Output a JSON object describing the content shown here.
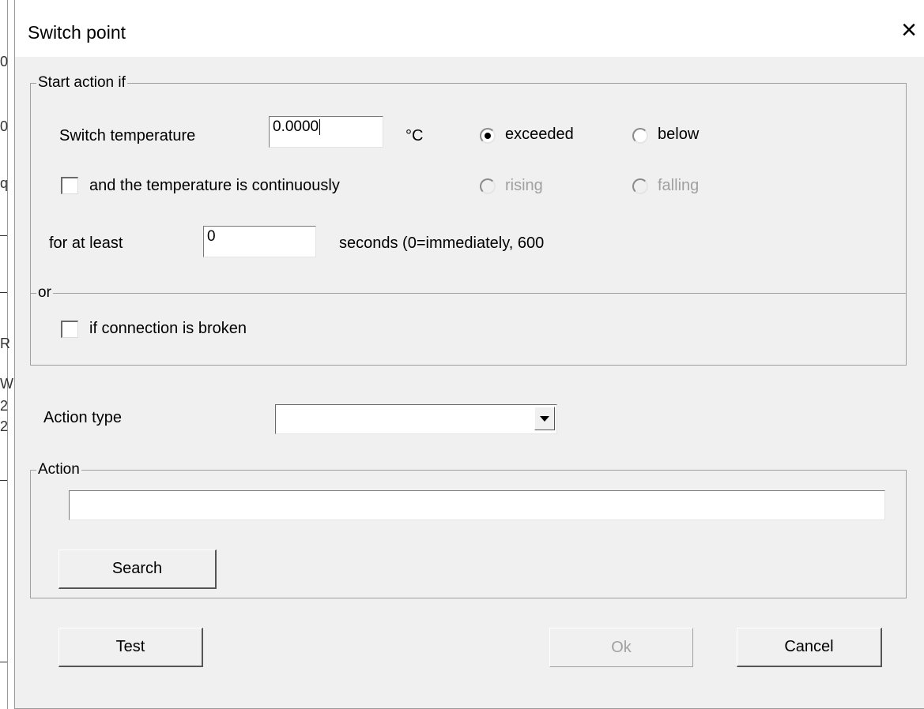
{
  "dialog": {
    "title": "Switch point",
    "close_glyph": "×"
  },
  "start_group": {
    "legend": "Start action if",
    "switch_temp_label": "Switch temperature",
    "switch_temp_value": "0.0000",
    "unit": "°C",
    "radio_exceeded": {
      "label": "exceeded",
      "checked": true
    },
    "radio_below": {
      "label": "below",
      "checked": false
    },
    "continuous_label": "and the temperature is continuously",
    "continuous_checked": false,
    "radio_rising": {
      "label": "rising",
      "enabled": false
    },
    "radio_falling": {
      "label": "falling",
      "enabled": false
    },
    "for_at_least_label": "for at least",
    "for_at_least_value": "0",
    "seconds_label": "seconds (0=immediately, 600",
    "or_legend": "or",
    "connection_broken_label": "if connection is broken",
    "connection_broken_checked": false
  },
  "action_type": {
    "label": "Action type",
    "selected_value": ""
  },
  "action_group": {
    "legend": "Action",
    "value": "",
    "search_label": "Search"
  },
  "buttons": {
    "test": "Test",
    "ok": "Ok",
    "cancel": "Cancel"
  },
  "background_glyphs": [
    "0",
    "0",
    "q",
    "R",
    "W",
    "2",
    "2"
  ]
}
